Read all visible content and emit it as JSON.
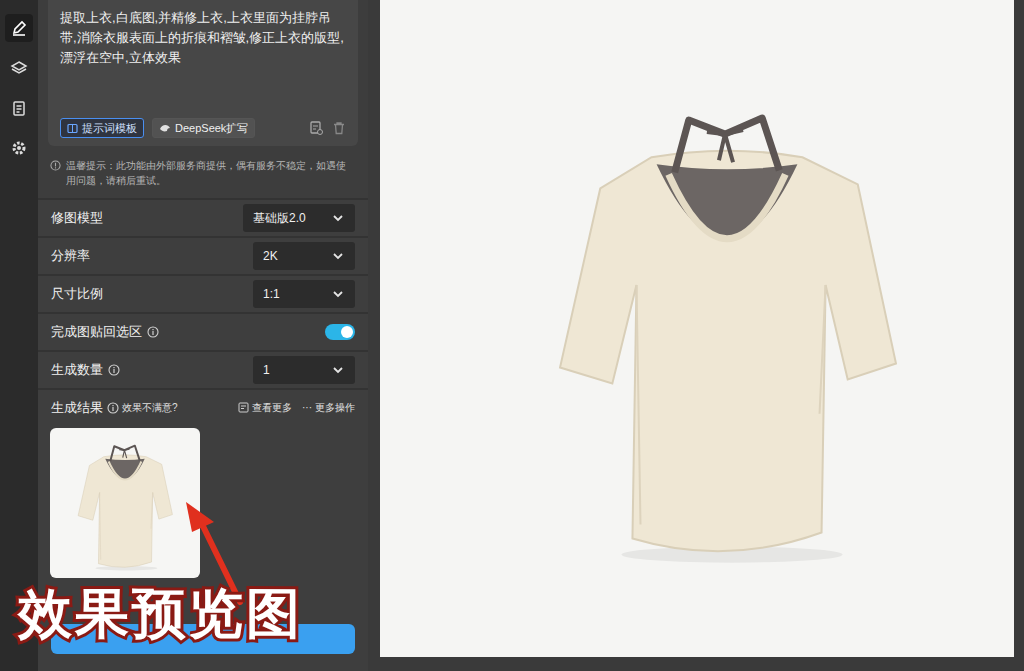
{
  "sidebar": {
    "items": [
      {
        "selected": true
      },
      {
        "selected": false
      },
      {
        "selected": false
      },
      {
        "selected": false
      }
    ]
  },
  "prompt": {
    "text": "提取上衣,白底图,并精修上衣,上衣里面为挂脖吊带,消除衣服表面上的折痕和褶皱,修正上衣的版型,漂浮在空中,立体效果",
    "buttons": [
      {
        "label": "提示词模板",
        "selected": true
      },
      {
        "label": "DeepSeek扩写",
        "selected": false
      }
    ]
  },
  "notice": "温馨提示：此功能由外部服务商提供，偶有服务不稳定，如遇使用问题，请稍后重试。",
  "settings": [
    {
      "label": "修图模型",
      "kind": "select",
      "info": false,
      "value": "基础版2.0"
    },
    {
      "label": "分辨率",
      "kind": "select",
      "info": false,
      "value": "2K"
    },
    {
      "label": "尺寸比例",
      "kind": "select",
      "info": false,
      "value": "1:1"
    },
    {
      "label": "完成图贴回选区",
      "kind": "toggle",
      "info": true,
      "on": true
    },
    {
      "label": "生成数量",
      "kind": "select",
      "info": true,
      "value": "1"
    }
  ],
  "results": {
    "title": "生成结果",
    "hint": "效果不满意?",
    "view_more": "查看更多",
    "more_icon": "···",
    "more_actions": "更多操作"
  },
  "annotation": {
    "text": "效果预览图"
  }
}
